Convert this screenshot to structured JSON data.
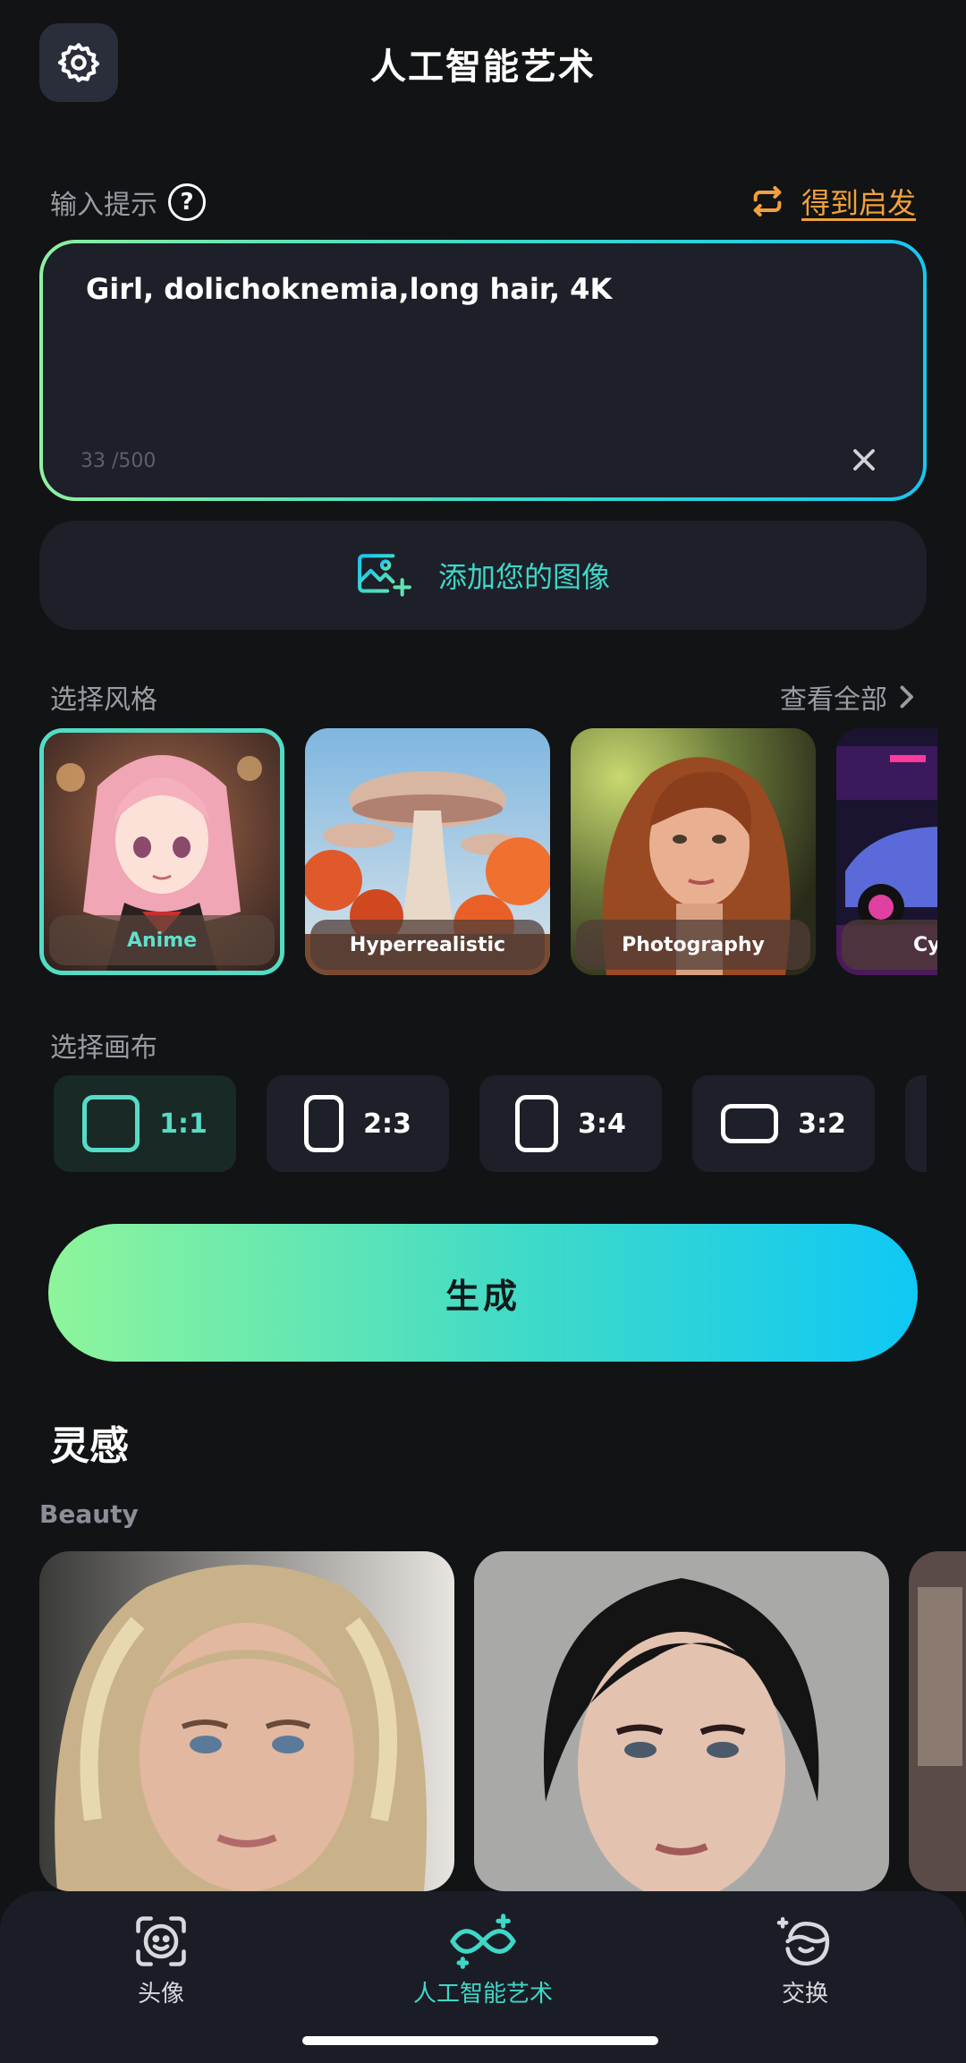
{
  "header": {
    "title": "人工智能艺术",
    "settings_icon": "gear-icon"
  },
  "prompt": {
    "label": "输入提示",
    "help_icon": "question-icon",
    "help_glyph": "?",
    "inspire_icon": "repeat-icon",
    "inspire_label": "得到启发",
    "value": "Girl, dolichoknemia,long hair, 4K",
    "char_count": "33 /500",
    "clear_icon": "close-icon"
  },
  "add_image": {
    "label": "添加您的图像",
    "icon": "add-image-icon"
  },
  "styles": {
    "label": "选择风格",
    "view_all": "查看全部",
    "items": [
      {
        "name": "Anime",
        "selected": true
      },
      {
        "name": "Hyperrealistic",
        "selected": false
      },
      {
        "name": "Photography",
        "selected": false
      },
      {
        "name": "Cyl",
        "selected": false
      }
    ]
  },
  "canvas": {
    "label": "选择画布",
    "ratios": [
      {
        "label": "1:1",
        "selected": true
      },
      {
        "label": "2:3",
        "selected": false
      },
      {
        "label": "3:4",
        "selected": false
      },
      {
        "label": "3:2",
        "selected": false
      }
    ]
  },
  "generate": {
    "label": "生成"
  },
  "inspiration": {
    "title": "灵感",
    "category": "Beauty"
  },
  "bottom_nav": {
    "items": [
      {
        "label": "头像",
        "icon": "face-frame-icon",
        "active": false
      },
      {
        "label": "人工智能艺术",
        "icon": "ai-art-icon",
        "active": true
      },
      {
        "label": "交换",
        "icon": "face-swap-icon",
        "active": false
      }
    ]
  },
  "colors": {
    "background": "#111315",
    "card": "#1d1f29",
    "accent": "#3fd7c8",
    "orange": "#f2a13a"
  }
}
